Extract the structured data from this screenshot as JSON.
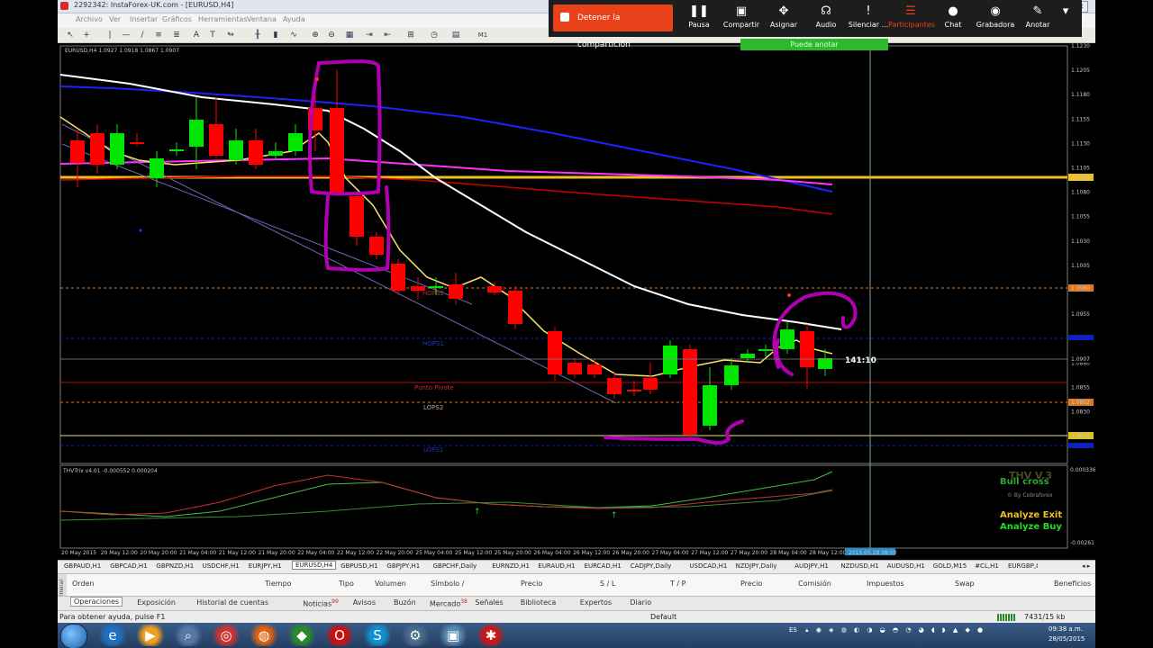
{
  "window": {
    "title": "2292342: InstaForex-UK.com - [EURUSD,H4]",
    "min": "—",
    "max": "□",
    "close": "✕"
  },
  "menu": [
    "Archivo",
    "Ver",
    "Insertar",
    "Gráficos",
    "Herramientas",
    "Ventana",
    "Ayuda"
  ],
  "share_panel": {
    "stop_label": "Detener la compartición",
    "may_annotate": "Puede anotar",
    "buttons": [
      "Pausa",
      "Compartir",
      "Asignar",
      "Audio",
      "Silenciar ...",
      "Participantes",
      "Chat",
      "Grabadora",
      "Anotar"
    ],
    "active_button": "Participantes",
    "active_color": "#e8421a"
  },
  "chart": {
    "symbol_header": "EURUSD,H4  1.0927 1.0918 1.0867 1.0907",
    "indicator_header": "THVTrix v4.01 -0.000552 0.000204",
    "price_labels": [
      "1.1230",
      "1.1205",
      "1.1180",
      "1.1155",
      "1.1130",
      "1.1105",
      "1.1080",
      "1.1055",
      "1.1030",
      "1.1005",
      "1.0980",
      "1.0955",
      "1.0930",
      "1.0907",
      "1.0880",
      "1.0855",
      "1.0830",
      "1.0805"
    ],
    "highlighted_prices": {
      "gold": "1.1094",
      "orange": "1.0980",
      "current": "1.0907",
      "lower": "1.0862",
      "yellow": "1.0828"
    },
    "indicator_scale": [
      "0.000336",
      "-0.00261"
    ],
    "pivot_labels": [
      "HOPS2",
      "HOPS1",
      "Punto Pivote",
      "LOPS2",
      "LOPS1"
    ],
    "crosshair_label": "141:10",
    "thv": {
      "title": "THV V.3",
      "cross": "Bull cross",
      "by": "© By Cobraforex",
      "exit": "Analyze Exit",
      "buy": "Analyze Buy"
    },
    "time_labels": [
      "20 May 2015",
      "20 May 12:00",
      "20 May 20:00",
      "21 May 04:00",
      "21 May 12:00",
      "21 May 20:00",
      "22 May 04:00",
      "22 May 12:00",
      "22 May 20:00",
      "25 May 04:00",
      "25 May 12:00",
      "25 May 20:00",
      "26 May 04:00",
      "26 May 12:00",
      "26 May 20:00",
      "27 May 04:00",
      "27 May 12:00",
      "27 May 20:00",
      "28 May 04:00",
      "28 May 12:00",
      "2015.05.28 08:00"
    ],
    "colors": {
      "bull": "#00e600",
      "bear": "#ff0000",
      "white_ma": "#ffffff",
      "yellow_ma": "#ffe066",
      "blue_ma": "#2020ff",
      "magenta_ma": "#ff33ff",
      "red_ma": "#cc0000",
      "annotation": "#b000b0"
    }
  },
  "symbol_tabs": [
    "GBPAUD,H1",
    "GBPCAD,H1",
    "GBPNZD,H1",
    "USDCHF,H1",
    "EURJPY,H1",
    "EURUSD,H4",
    "GBPUSD,H1",
    "GBPJPY,H1",
    "GBPCHF,Daily",
    "EURNZD,H1",
    "EURAUD,H1",
    "EURCAD,H1",
    "CADJPY,Daily",
    "USDCAD,H1",
    "NZDJPY,Daily",
    "AUDJPY,H1",
    "NZDUSD,H1",
    "AUDUSD,H1",
    "GOLD,M15",
    "#CL,H1",
    "EURGBP,I"
  ],
  "active_symbol_tab": "EURUSD,H4",
  "terminal_columns": [
    "Orden",
    "Tiempo",
    "Tipo",
    "Volumen",
    "Símbolo /",
    "Precio",
    "S / L",
    "T / P",
    "Precio",
    "Comisión",
    "Impuestos",
    "Swap",
    "Beneficios"
  ],
  "terminal_side_label": "Terminal",
  "terminal_tabs": [
    "Operaciones",
    "Exposición",
    "Historial de cuentas",
    "Noticias",
    "Avisos",
    "Buzón",
    "Mercado",
    "Señales",
    "Biblioteca",
    "Expertos",
    "Diario"
  ],
  "terminal_badges": {
    "Noticias": "99",
    "Mercado": "38"
  },
  "status": {
    "help": "Para obtener ayuda, pulse F1",
    "profile": "Default",
    "traffic": "7431/15 kb"
  },
  "taskbar": {
    "apps": [
      "ie-icon",
      "media-player-icon",
      "search-icon",
      "chrome-icon",
      "firefox-icon",
      "forex-icon",
      "opera-icon",
      "skype-icon",
      "network-icon",
      "vm-icon",
      "instaforex-icon"
    ],
    "lang": "ES",
    "time": "09:38 a.m.",
    "date": "28/05/2015"
  }
}
